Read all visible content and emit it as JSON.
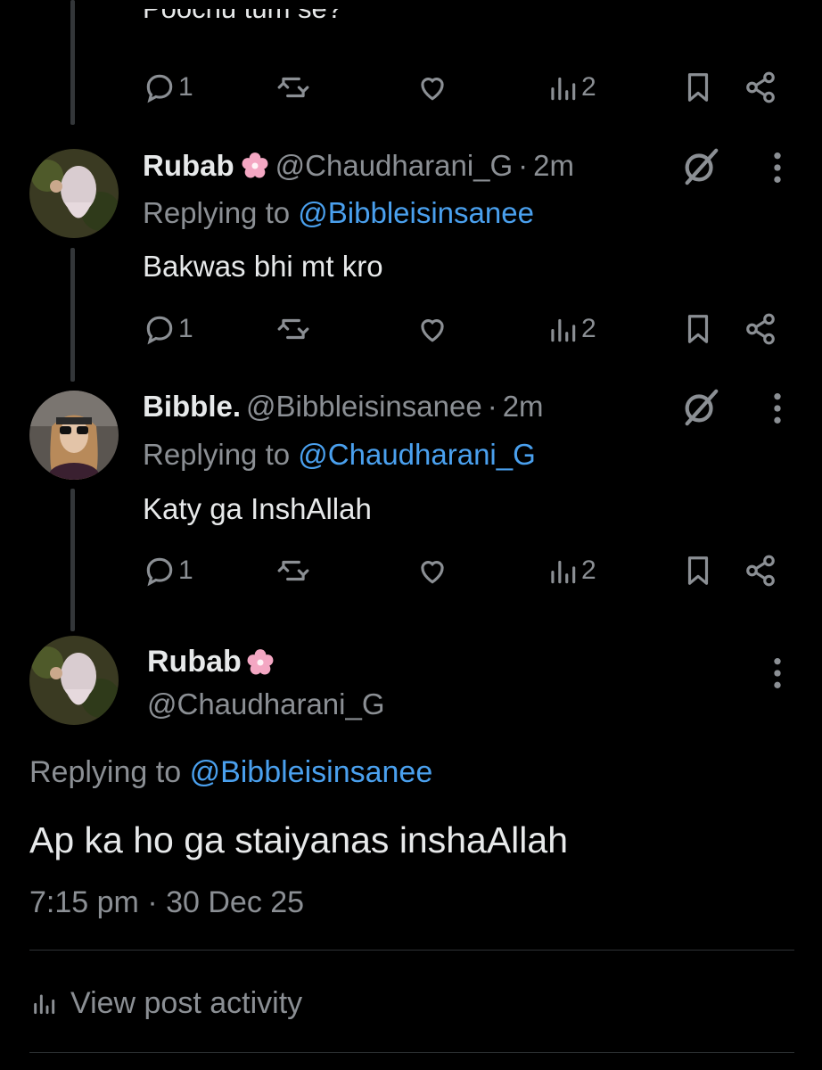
{
  "top_cutoff_text": "Poochu tum se?",
  "tweets": [
    {
      "actions": {
        "reply_count": "1",
        "view_count": "2"
      }
    },
    {
      "name": "Rubab",
      "handle": "@Chaudharani_G",
      "separator": "·",
      "time": "2m",
      "replying_prefix": "Replying to",
      "replying_to": "@Bibbleisinsanee",
      "text": "Bakwas bhi mt kro",
      "actions": {
        "reply_count": "1",
        "view_count": "2"
      }
    },
    {
      "name": "Bibble.",
      "handle": "@Bibbleisinsanee",
      "separator": "·",
      "time": "2m",
      "replying_prefix": "Replying to",
      "replying_to": "@Chaudharani_G",
      "text": "Katy ga InshAllah",
      "actions": {
        "reply_count": "1",
        "view_count": "2"
      }
    }
  ],
  "main_tweet": {
    "name": "Rubab",
    "handle": "@Chaudharani_G",
    "replying_prefix": "Replying to",
    "replying_to": "@Bibbleisinsanee",
    "text": "Ap ka ho ga staiyanas inshaAllah",
    "time": "7:15 pm",
    "separator": "·",
    "date": "30 Dec 25"
  },
  "view_activity_label": "View post activity",
  "icons": {
    "reply": "reply-icon",
    "repost": "repost-icon",
    "like": "heart-icon",
    "views": "views-icon",
    "bookmark": "bookmark-icon",
    "share": "share-icon",
    "more": "more-icon",
    "grok": "grok-icon",
    "name_emoji": "cherry-blossom-icon"
  },
  "colors": {
    "background": "#000000",
    "text": "#e7e9ea",
    "muted": "#8b8f94",
    "link": "#4aa0ee",
    "thread_line": "#333639"
  }
}
